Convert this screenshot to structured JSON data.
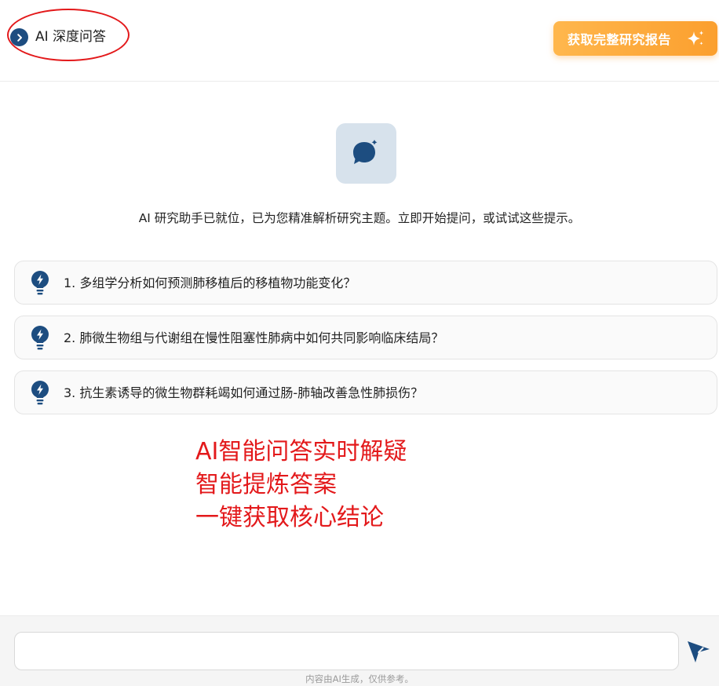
{
  "header": {
    "title": "AI 深度问答",
    "report_button_label": "获取完整研究报告"
  },
  "hero": {
    "welcome": "AI 研究助手已就位，已为您精准解析研究主题。立即开始提问，或试试这些提示。"
  },
  "suggestions": [
    {
      "text": "1. 多组学分析如何预测肺移植后的移植物功能变化？"
    },
    {
      "text": "2. 肺微生物组与代谢组在慢性阻塞性肺病中如何共同影响临床结局？"
    },
    {
      "text": "3. 抗生素诱导的微生物群耗竭如何通过肠-肺轴改善急性肺损伤？"
    }
  ],
  "annotation": {
    "lines": [
      "AI智能问答实时解疑",
      "智能提炼答案",
      "一键获取核心结论"
    ]
  },
  "input": {
    "value": "",
    "placeholder": ""
  },
  "footer": {
    "disclaimer": "内容由AI生成，仅供参考。"
  },
  "colors": {
    "accent_navy": "#1d4d80",
    "accent_orange": "#fb9f2e",
    "annotation_red": "#e3191b"
  },
  "icons": {
    "back": "chevron-right-icon",
    "sparkle": "sparkle-icon",
    "assistant": "chat-sparkle-icon",
    "suggestion": "lightbulb-icon",
    "send": "send-icon"
  }
}
